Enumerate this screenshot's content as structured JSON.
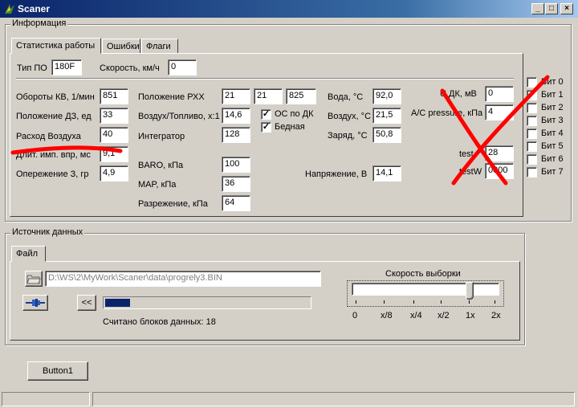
{
  "window": {
    "title": "Scaner",
    "min": "_",
    "max": "□",
    "close": "×"
  },
  "info_group": {
    "title": "Информация",
    "tabs": [
      "Статистика работы",
      "Ошибки",
      "Флаги"
    ],
    "tip_po": {
      "label": "Тип ПО",
      "value": "180F"
    },
    "speed": {
      "label": "Скорость, км/ч",
      "value": "0"
    },
    "col1": [
      {
        "label": "Обороты КВ, 1/мин",
        "value": "851"
      },
      {
        "label": "Положение ДЗ, ед",
        "value": "33"
      },
      {
        "label": "Расход Воздуха",
        "value": "40"
      },
      {
        "label": "Длит. имп. впр, мс",
        "value": "9,1"
      },
      {
        "label": "Опережение З, гр",
        "value": "4,9"
      }
    ],
    "col2": {
      "rxx": {
        "label": "Положение РХХ",
        "v1": "21",
        "v2": "21",
        "v3": "825"
      },
      "air_fuel": {
        "label": "Воздух/Топливо, x:1",
        "value": "14,6"
      },
      "integrator": {
        "label": "Интегратор",
        "value": "128"
      },
      "os_dk": "ОС по ДК",
      "bednaya": "Бедная",
      "baro": {
        "label": "BARO, кПа",
        "value": "100"
      },
      "map": {
        "label": "MAP, кПа",
        "value": "36"
      },
      "razr": {
        "label": "Разрежение, кПа",
        "value": "64"
      }
    },
    "col3": [
      {
        "label": "Вода,    °C",
        "value": "92,0"
      },
      {
        "label": "Воздух, °C",
        "value": "21,5"
      },
      {
        "label": "Заряд,  °C",
        "value": "50,8"
      }
    ],
    "voltage": {
      "label": "Напряжение, В",
      "value": "14,1"
    },
    "col4": {
      "u_dk": {
        "label": "U ДК, мВ",
        "value": "0"
      },
      "ac": {
        "label": "A/C pressure, кПа",
        "value": "4"
      },
      "test": {
        "label": "test",
        "value": "28"
      },
      "testw": {
        "label": "testW",
        "value": "0000"
      }
    },
    "bits": [
      {
        "label": "Бит 0",
        "checked": false
      },
      {
        "label": "Бит 1",
        "checked": true
      },
      {
        "label": "Бит 2",
        "checked": false
      },
      {
        "label": "Бит 3",
        "checked": false
      },
      {
        "label": "Бит 4",
        "checked": false
      },
      {
        "label": "Бит 5",
        "checked": false
      },
      {
        "label": "Бит 6",
        "checked": false
      },
      {
        "label": "Бит 7",
        "checked": false
      }
    ]
  },
  "source_group": {
    "title": "Источник данных",
    "tab": "Файл",
    "path": "D:\\WS\\2\\MyWork\\Scaner\\data\\progrely3.BIN",
    "back_label": "<<",
    "progress": 0.12,
    "blocks_read": "Считано блоков данных: 18",
    "speed_title": "Скорость выборки",
    "speed_ticks": [
      "0",
      "x/8",
      "x/4",
      "x/2",
      "1x",
      "2x"
    ],
    "speed_value": "1x"
  },
  "button1": "Button1",
  "colors": {
    "title_start": "#0a246a",
    "title_end": "#a6caf0",
    "annotation_red": "#ff0000",
    "progress": "#0a246a"
  }
}
